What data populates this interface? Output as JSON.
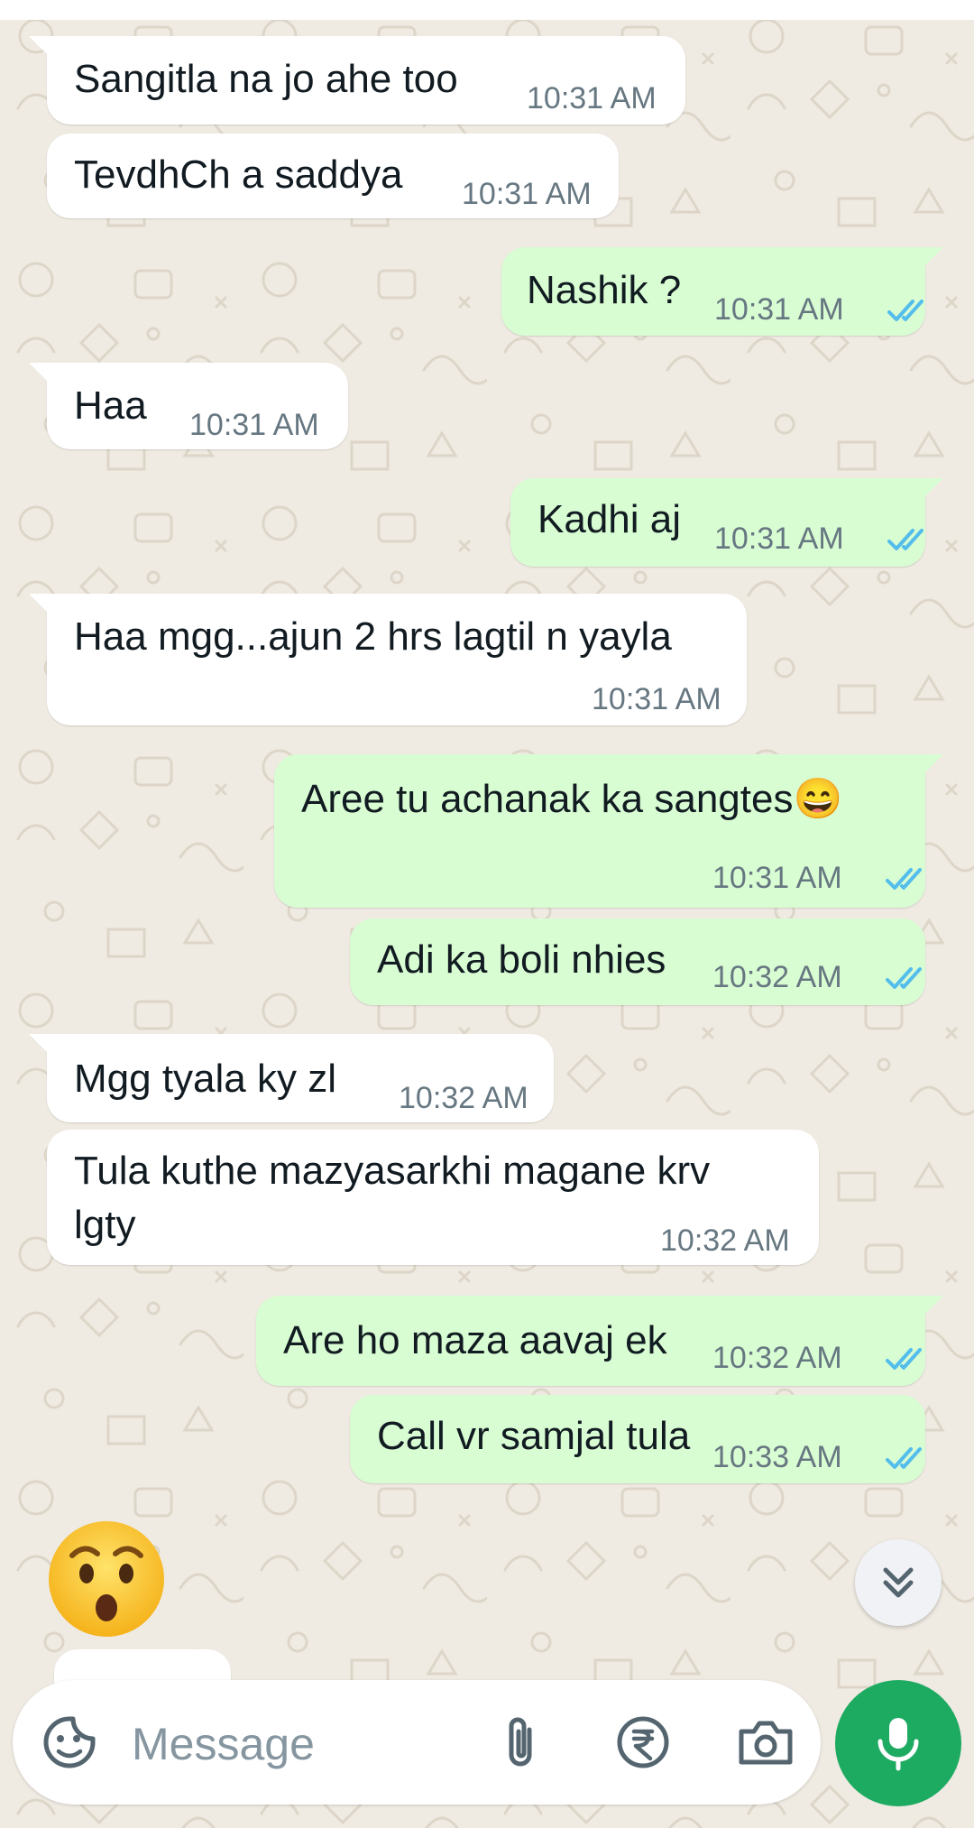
{
  "messages": [
    {
      "dir": "in",
      "text": "Sangitla na jo ahe too",
      "time": "10:31 AM",
      "tail": true
    },
    {
      "dir": "in",
      "text": "TevdhCh a saddya",
      "time": "10:31 AM",
      "tail": false
    },
    {
      "dir": "out",
      "text": "Nashik ?",
      "time": "10:31 AM",
      "tail": true,
      "status": "read"
    },
    {
      "dir": "in",
      "text": "Haa",
      "time": "10:31 AM",
      "tail": true
    },
    {
      "dir": "out",
      "text": "Kadhi aj",
      "time": "10:31 AM",
      "tail": true,
      "status": "read"
    },
    {
      "dir": "in",
      "text": "Haa mgg...ajun 2 hrs lagtil n yayla",
      "time": "10:31 AM",
      "tail": true
    },
    {
      "dir": "out",
      "text": "Aree tu achanak ka sangtes😄",
      "time": "10:31 AM",
      "tail": true,
      "status": "read"
    },
    {
      "dir": "out",
      "text": "Adi ka boli nhies",
      "time": "10:32 AM",
      "tail": false,
      "status": "read"
    },
    {
      "dir": "in",
      "text": "Mgg tyala ky zl",
      "time": "10:32 AM",
      "tail": true
    },
    {
      "dir": "in",
      "text": "Tula kuthe mazyasarkhi magane krv\nlgty",
      "time": "10:32 AM",
      "tail": false
    },
    {
      "dir": "out",
      "text": "Are ho maza aavaj ek",
      "time": "10:32 AM",
      "tail": true,
      "status": "read"
    },
    {
      "dir": "out",
      "text": "Call vr samjal tula",
      "time": "10:33 AM",
      "tail": false,
      "status": "read"
    }
  ],
  "sticker": {
    "icon": "hushed-face-emoji"
  },
  "composer": {
    "placeholder": "Message"
  },
  "icons": {
    "emoji": "sticker-smiley-icon",
    "attach": "paperclip-icon",
    "payment": "rupee-icon",
    "camera": "camera-icon",
    "mic": "microphone-icon",
    "scroll": "double-chevron-down-icon"
  },
  "colors": {
    "wallpaper": "#efeae2",
    "incoming_bubble": "#ffffff",
    "outgoing_bubble": "#d9fdd3",
    "read_ticks": "#53bdeb",
    "mic_button": "#1daa61",
    "timestamp": "#667781"
  }
}
